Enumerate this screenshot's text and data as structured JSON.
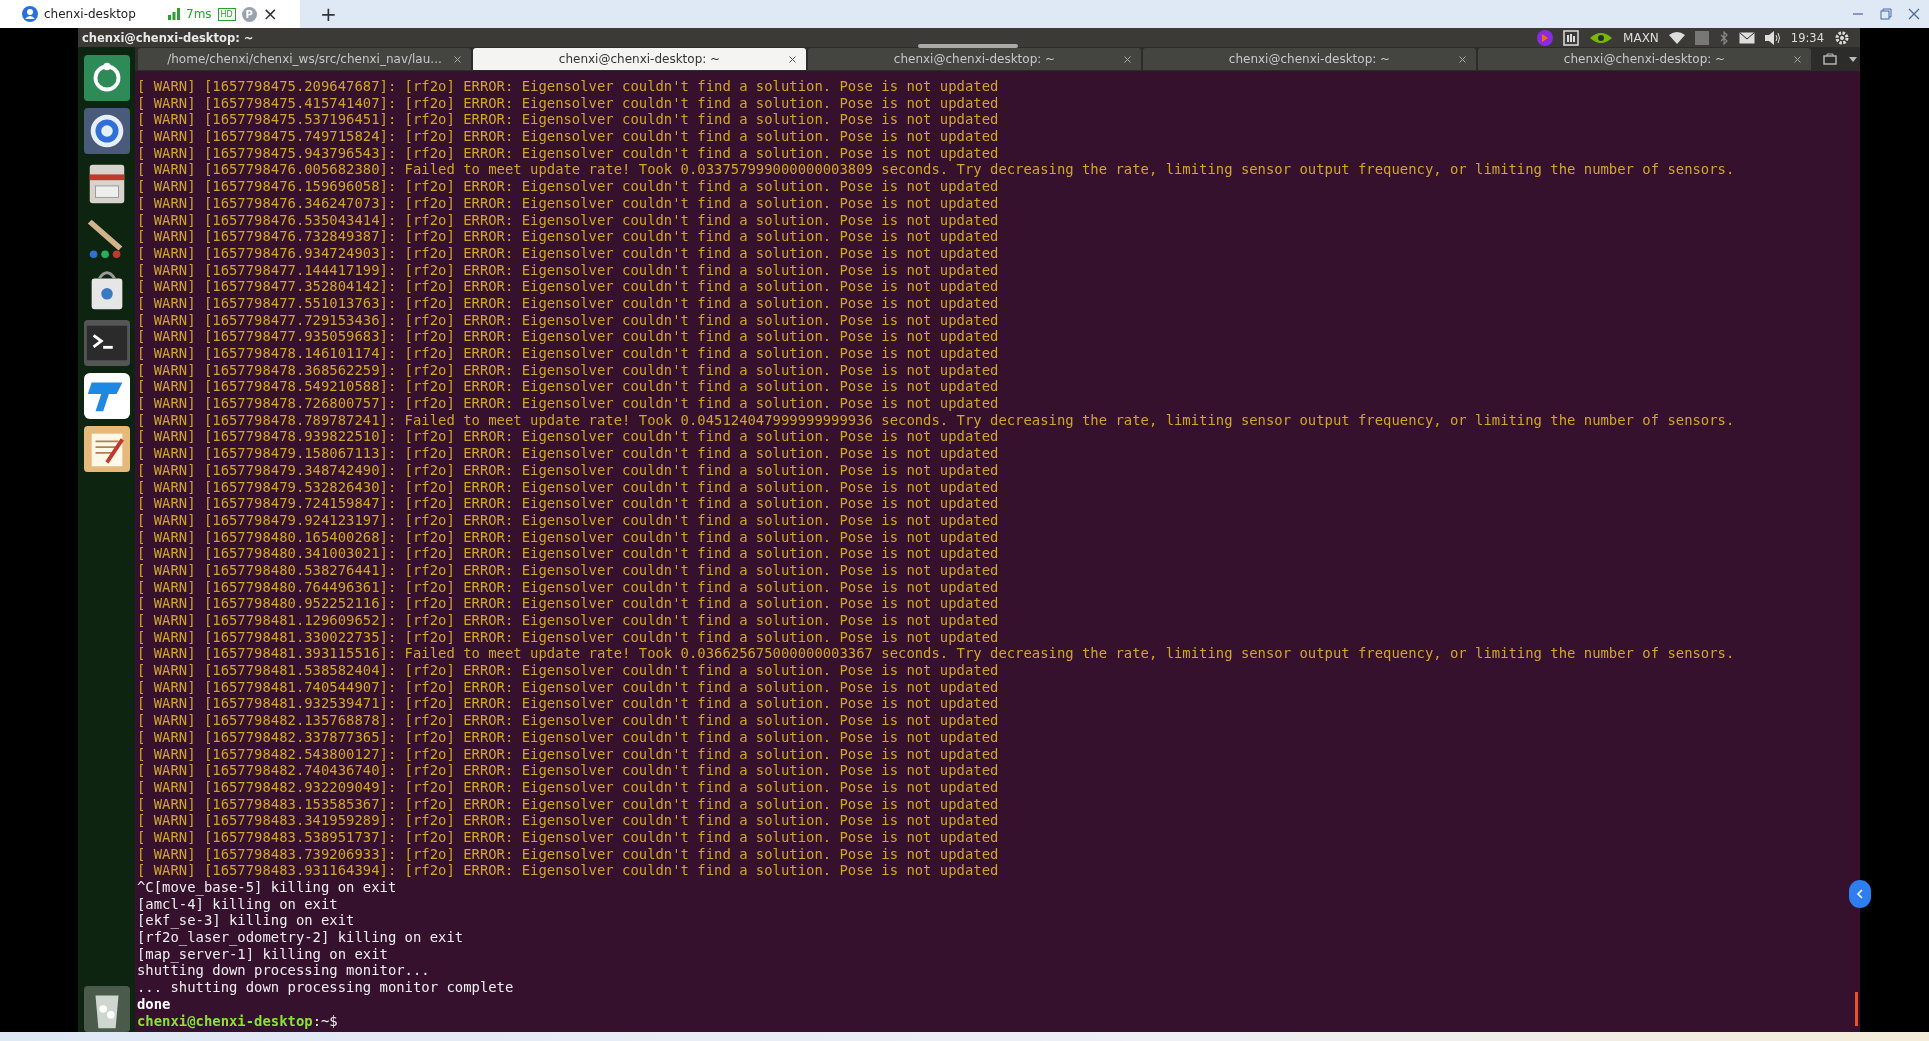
{
  "browser_tab": {
    "title": "chenxi-desktop",
    "latency": "7ms",
    "badge": "HD",
    "profile": "P",
    "close": "×",
    "new_tab": "+"
  },
  "remote": {
    "window_title": "chenxi@chenxi-desktop: ~",
    "tray": {
      "power_mode": "MAXN",
      "time": "19:34"
    },
    "tabs": [
      {
        "label": "/home/chenxi/chenxi_ws/src/chenxi_nav/lau...",
        "selected": false
      },
      {
        "label": "chenxi@chenxi-desktop: ~",
        "selected": true
      },
      {
        "label": "chenxi@chenxi-desktop: ~",
        "selected": false
      },
      {
        "label": "chenxi@chenxi-desktop: ~",
        "selected": false
      },
      {
        "label": "chenxi@chenxi-desktop: ~",
        "selected": false
      }
    ],
    "terminal": {
      "lines": [
        {
          "kind": "warn",
          "text": "[ WARN] [1657798475.209647687]: [rf2o] ERROR: Eigensolver couldn't find a solution. Pose is not updated"
        },
        {
          "kind": "warn",
          "text": "[ WARN] [1657798475.415741407]: [rf2o] ERROR: Eigensolver couldn't find a solution. Pose is not updated"
        },
        {
          "kind": "warn",
          "text": "[ WARN] [1657798475.537196451]: [rf2o] ERROR: Eigensolver couldn't find a solution. Pose is not updated"
        },
        {
          "kind": "warn",
          "text": "[ WARN] [1657798475.749715824]: [rf2o] ERROR: Eigensolver couldn't find a solution. Pose is not updated"
        },
        {
          "kind": "warn",
          "text": "[ WARN] [1657798475.943796543]: [rf2o] ERROR: Eigensolver couldn't find a solution. Pose is not updated"
        },
        {
          "kind": "warn",
          "text": "[ WARN] [1657798476.005682380]: Failed to meet update rate! Took 0.033757999000000003809 seconds. Try decreasing the rate, limiting sensor output frequency, or limiting the number of sensors."
        },
        {
          "kind": "warn",
          "text": "[ WARN] [1657798476.159696058]: [rf2o] ERROR: Eigensolver couldn't find a solution. Pose is not updated"
        },
        {
          "kind": "warn",
          "text": "[ WARN] [1657798476.346247073]: [rf2o] ERROR: Eigensolver couldn't find a solution. Pose is not updated"
        },
        {
          "kind": "warn",
          "text": "[ WARN] [1657798476.535043414]: [rf2o] ERROR: Eigensolver couldn't find a solution. Pose is not updated"
        },
        {
          "kind": "warn",
          "text": "[ WARN] [1657798476.732849387]: [rf2o] ERROR: Eigensolver couldn't find a solution. Pose is not updated"
        },
        {
          "kind": "warn",
          "text": "[ WARN] [1657798476.934724903]: [rf2o] ERROR: Eigensolver couldn't find a solution. Pose is not updated"
        },
        {
          "kind": "warn",
          "text": "[ WARN] [1657798477.144417199]: [rf2o] ERROR: Eigensolver couldn't find a solution. Pose is not updated"
        },
        {
          "kind": "warn",
          "text": "[ WARN] [1657798477.352804142]: [rf2o] ERROR: Eigensolver couldn't find a solution. Pose is not updated"
        },
        {
          "kind": "warn",
          "text": "[ WARN] [1657798477.551013763]: [rf2o] ERROR: Eigensolver couldn't find a solution. Pose is not updated"
        },
        {
          "kind": "warn",
          "text": "[ WARN] [1657798477.729153436]: [rf2o] ERROR: Eigensolver couldn't find a solution. Pose is not updated"
        },
        {
          "kind": "warn",
          "text": "[ WARN] [1657798477.935059683]: [rf2o] ERROR: Eigensolver couldn't find a solution. Pose is not updated"
        },
        {
          "kind": "warn",
          "text": "[ WARN] [1657798478.146101174]: [rf2o] ERROR: Eigensolver couldn't find a solution. Pose is not updated"
        },
        {
          "kind": "warn",
          "text": "[ WARN] [1657798478.368562259]: [rf2o] ERROR: Eigensolver couldn't find a solution. Pose is not updated"
        },
        {
          "kind": "warn",
          "text": "[ WARN] [1657798478.549210588]: [rf2o] ERROR: Eigensolver couldn't find a solution. Pose is not updated"
        },
        {
          "kind": "warn",
          "text": "[ WARN] [1657798478.726800757]: [rf2o] ERROR: Eigensolver couldn't find a solution. Pose is not updated"
        },
        {
          "kind": "warn",
          "text": "[ WARN] [1657798478.789787241]: Failed to meet update rate! Took 0.045124047999999999936 seconds. Try decreasing the rate, limiting sensor output frequency, or limiting the number of sensors."
        },
        {
          "kind": "warn",
          "text": "[ WARN] [1657798478.939822510]: [rf2o] ERROR: Eigensolver couldn't find a solution. Pose is not updated"
        },
        {
          "kind": "warn",
          "text": "[ WARN] [1657798479.158067113]: [rf2o] ERROR: Eigensolver couldn't find a solution. Pose is not updated"
        },
        {
          "kind": "warn",
          "text": "[ WARN] [1657798479.348742490]: [rf2o] ERROR: Eigensolver couldn't find a solution. Pose is not updated"
        },
        {
          "kind": "warn",
          "text": "[ WARN] [1657798479.532826430]: [rf2o] ERROR: Eigensolver couldn't find a solution. Pose is not updated"
        },
        {
          "kind": "warn",
          "text": "[ WARN] [1657798479.724159847]: [rf2o] ERROR: Eigensolver couldn't find a solution. Pose is not updated"
        },
        {
          "kind": "warn",
          "text": "[ WARN] [1657798479.924123197]: [rf2o] ERROR: Eigensolver couldn't find a solution. Pose is not updated"
        },
        {
          "kind": "warn",
          "text": "[ WARN] [1657798480.165400268]: [rf2o] ERROR: Eigensolver couldn't find a solution. Pose is not updated"
        },
        {
          "kind": "warn",
          "text": "[ WARN] [1657798480.341003021]: [rf2o] ERROR: Eigensolver couldn't find a solution. Pose is not updated"
        },
        {
          "kind": "warn",
          "text": "[ WARN] [1657798480.538276441]: [rf2o] ERROR: Eigensolver couldn't find a solution. Pose is not updated"
        },
        {
          "kind": "warn",
          "text": "[ WARN] [1657798480.764496361]: [rf2o] ERROR: Eigensolver couldn't find a solution. Pose is not updated"
        },
        {
          "kind": "warn",
          "text": "[ WARN] [1657798480.952252116]: [rf2o] ERROR: Eigensolver couldn't find a solution. Pose is not updated"
        },
        {
          "kind": "warn",
          "text": "[ WARN] [1657798481.129609652]: [rf2o] ERROR: Eigensolver couldn't find a solution. Pose is not updated"
        },
        {
          "kind": "warn",
          "text": "[ WARN] [1657798481.330022735]: [rf2o] ERROR: Eigensolver couldn't find a solution. Pose is not updated"
        },
        {
          "kind": "warn",
          "text": "[ WARN] [1657798481.393115516]: Failed to meet update rate! Took 0.036625675000000003367 seconds. Try decreasing the rate, limiting sensor output frequency, or limiting the number of sensors."
        },
        {
          "kind": "warn",
          "text": "[ WARN] [1657798481.538582404]: [rf2o] ERROR: Eigensolver couldn't find a solution. Pose is not updated"
        },
        {
          "kind": "warn",
          "text": "[ WARN] [1657798481.740544907]: [rf2o] ERROR: Eigensolver couldn't find a solution. Pose is not updated"
        },
        {
          "kind": "warn",
          "text": "[ WARN] [1657798481.932539471]: [rf2o] ERROR: Eigensolver couldn't find a solution. Pose is not updated"
        },
        {
          "kind": "warn",
          "text": "[ WARN] [1657798482.135768878]: [rf2o] ERROR: Eigensolver couldn't find a solution. Pose is not updated"
        },
        {
          "kind": "warn",
          "text": "[ WARN] [1657798482.337877365]: [rf2o] ERROR: Eigensolver couldn't find a solution. Pose is not updated"
        },
        {
          "kind": "warn",
          "text": "[ WARN] [1657798482.543800127]: [rf2o] ERROR: Eigensolver couldn't find a solution. Pose is not updated"
        },
        {
          "kind": "warn",
          "text": "[ WARN] [1657798482.740436740]: [rf2o] ERROR: Eigensolver couldn't find a solution. Pose is not updated"
        },
        {
          "kind": "warn",
          "text": "[ WARN] [1657798482.932209049]: [rf2o] ERROR: Eigensolver couldn't find a solution. Pose is not updated"
        },
        {
          "kind": "warn",
          "text": "[ WARN] [1657798483.153585367]: [rf2o] ERROR: Eigensolver couldn't find a solution. Pose is not updated"
        },
        {
          "kind": "warn",
          "text": "[ WARN] [1657798483.341959289]: [rf2o] ERROR: Eigensolver couldn't find a solution. Pose is not updated"
        },
        {
          "kind": "warn",
          "text": "[ WARN] [1657798483.538951737]: [rf2o] ERROR: Eigensolver couldn't find a solution. Pose is not updated"
        },
        {
          "kind": "warn",
          "text": "[ WARN] [1657798483.739206933]: [rf2o] ERROR: Eigensolver couldn't find a solution. Pose is not updated"
        },
        {
          "kind": "warn",
          "text": "[ WARN] [1657798483.931164394]: [rf2o] ERROR: Eigensolver couldn't find a solution. Pose is not updated"
        },
        {
          "kind": "plain",
          "text": "^C[move_base-5] killing on exit"
        },
        {
          "kind": "plain",
          "text": "[amcl-4] killing on exit"
        },
        {
          "kind": "plain",
          "text": "[ekf_se-3] killing on exit"
        },
        {
          "kind": "plain",
          "text": "[rf2o_laser_odometry-2] killing on exit"
        },
        {
          "kind": "plain",
          "text": "[map_server-1] killing on exit"
        },
        {
          "kind": "plain",
          "text": "shutting down processing monitor..."
        },
        {
          "kind": "plain",
          "text": "... shutting down processing monitor complete"
        },
        {
          "kind": "bold",
          "text": "done"
        },
        {
          "kind": "prompt",
          "user": "chenxi@chenxi-desktop",
          "path": ":~$"
        }
      ]
    }
  }
}
